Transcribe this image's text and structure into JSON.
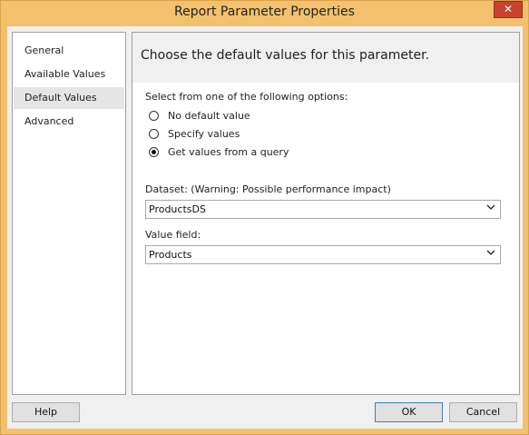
{
  "window": {
    "title": "Report Parameter Properties",
    "close_glyph": "✕"
  },
  "nav": {
    "items": [
      {
        "label": "General"
      },
      {
        "label": "Available Values"
      },
      {
        "label": "Default Values",
        "selected": true
      },
      {
        "label": "Advanced"
      }
    ]
  },
  "content": {
    "heading": "Choose the default values for this parameter.",
    "options_label": "Select from one of the following options:",
    "options": [
      {
        "label": "No default value",
        "checked": false
      },
      {
        "label": "Specify values",
        "checked": false
      },
      {
        "label": "Get values from a query",
        "checked": true
      }
    ],
    "dataset_label": "Dataset: (Warning: Possible performance impact)",
    "dataset_value": "ProductsDS",
    "value_field_label": "Value field:",
    "value_field_value": "Products"
  },
  "buttons": {
    "help": "Help",
    "ok": "OK",
    "cancel": "Cancel"
  },
  "icons": {
    "dropdown": "chevron-down-icon"
  }
}
